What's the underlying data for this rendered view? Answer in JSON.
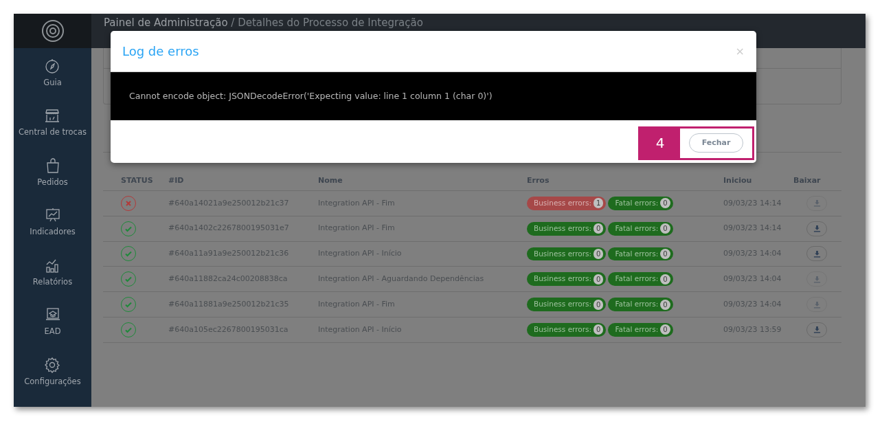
{
  "header": {
    "title": "Painel de Administração",
    "subtitle": "/ Detalhes do Processo de Integração"
  },
  "sidebar": {
    "items": [
      {
        "label": "Guia"
      },
      {
        "label": "Central de trocas"
      },
      {
        "label": "Pedidos"
      },
      {
        "label": "Indicadores"
      },
      {
        "label": "Relatórios"
      },
      {
        "label": "EAD"
      },
      {
        "label": "Configurações"
      }
    ]
  },
  "table": {
    "columns": [
      "STATUS",
      "#ID",
      "Nome",
      "Erros",
      "Iniciou",
      "Baixar"
    ],
    "rows": [
      {
        "kind": "error",
        "id": "#640a14021a9e250012b21c37",
        "name": "Integration API - Fim",
        "errors": [
          {
            "label": "Business errors:",
            "count": "1",
            "alert": true
          },
          {
            "label": "Fatal errors:",
            "count": "0",
            "alert": false
          }
        ],
        "started": "09/03/23 14:14",
        "download_disabled": true
      },
      {
        "kind": "success",
        "id": "#640a1402c2267800195031e7",
        "name": "Integration API - Fim",
        "errors": [
          {
            "label": "Business errors:",
            "count": "0",
            "alert": false
          },
          {
            "label": "Fatal errors:",
            "count": "0",
            "alert": false
          }
        ],
        "started": "09/03/23 14:14",
        "download_disabled": false
      },
      {
        "kind": "success",
        "id": "#640a11a91a9e250012b21c36",
        "name": "Integration API - Início",
        "errors": [
          {
            "label": "Business errors:",
            "count": "0",
            "alert": false
          },
          {
            "label": "Fatal errors:",
            "count": "0",
            "alert": false
          }
        ],
        "started": "09/03/23 14:04",
        "download_disabled": false
      },
      {
        "kind": "success",
        "id": "#640a11882ca24c00208838ca",
        "name": "Integration API - Aguardando Dependências",
        "errors": [
          {
            "label": "Business errors:",
            "count": "0",
            "alert": false
          },
          {
            "label": "Fatal errors:",
            "count": "0",
            "alert": false
          }
        ],
        "started": "09/03/23 14:04",
        "download_disabled": true
      },
      {
        "kind": "success",
        "id": "#640a11881a9e250012b21c35",
        "name": "Integration API - Fim",
        "errors": [
          {
            "label": "Business errors:",
            "count": "0",
            "alert": false
          },
          {
            "label": "Fatal errors:",
            "count": "0",
            "alert": false
          }
        ],
        "started": "09/03/23 14:04",
        "download_disabled": true
      },
      {
        "kind": "success",
        "id": "#640a105ec2267800195031ca",
        "name": "Integration API - Início",
        "errors": [
          {
            "label": "Business errors:",
            "count": "0",
            "alert": false
          },
          {
            "label": "Fatal errors:",
            "count": "0",
            "alert": false
          }
        ],
        "started": "09/03/23 13:59",
        "download_disabled": false
      }
    ]
  },
  "modal": {
    "title": "Log de erros",
    "close": "×",
    "message": "Cannot encode object: JSONDecodeError('Expecting value: line 1 column 1 (char 0)')",
    "button": "Fechar"
  },
  "annotation": {
    "label": "4"
  }
}
